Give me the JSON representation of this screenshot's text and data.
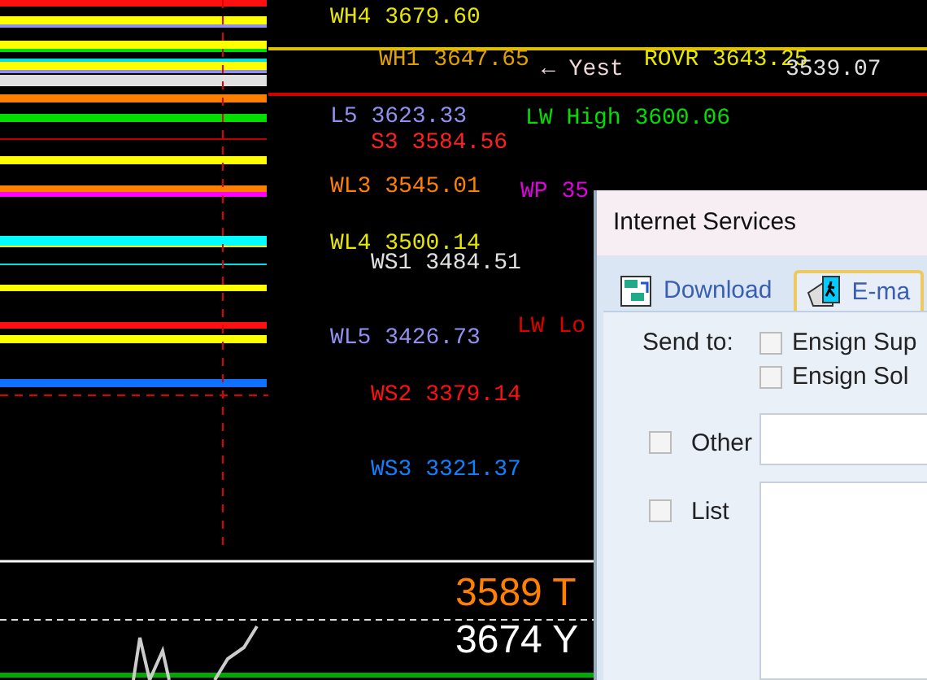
{
  "chart": {
    "labels": [
      {
        "text": "WH4 3679.60",
        "color": "#e6e600"
      },
      {
        "text": "WH1 3647.65",
        "color": "#e0a000"
      },
      {
        "text": "ROVR 3643.25",
        "color": "#e6e600"
      },
      {
        "text": "← Yest",
        "color": "#f0d8d8"
      },
      {
        "text": "3539.07",
        "color": "#e0e0e0"
      },
      {
        "text": "L5 3623.33",
        "color": "#9090f0"
      },
      {
        "text": "S3 3584.56",
        "color": "#ff2020"
      },
      {
        "text": "LW High 3600.06",
        "color": "#00e000"
      },
      {
        "text": "WL3 3545.01",
        "color": "#ff8000"
      },
      {
        "text": "WP 35",
        "color": "#e000e0"
      },
      {
        "text": "WL4 3500.14",
        "color": "#e6e600"
      },
      {
        "text": "WS1 3484.51",
        "color": "#e0e0e0"
      },
      {
        "text": "LW Lo",
        "color": "#e00000"
      },
      {
        "text": "WL5 3426.73",
        "color": "#9090f0"
      },
      {
        "text": "WS2 3379.14",
        "color": "#ff1010"
      },
      {
        "text": "WS3 3321.37",
        "color": "#1080ff"
      }
    ],
    "readings": [
      {
        "text": "3589 T",
        "color": "#ff8000"
      },
      {
        "text": "3674 Y",
        "color": "#ffffff"
      }
    ]
  },
  "dialog": {
    "title": "Internet Services",
    "tabs": [
      {
        "label": "Download",
        "selected": false
      },
      {
        "label": "E-ma",
        "selected": true
      }
    ],
    "send_to_label": "Send to:",
    "recipients": [
      {
        "label": "Ensign Sup",
        "checked": false
      },
      {
        "label": "Ensign Sol",
        "checked": false
      }
    ],
    "other": {
      "label": "Other",
      "checked": false
    },
    "list": {
      "label": "List",
      "checked": false
    }
  }
}
